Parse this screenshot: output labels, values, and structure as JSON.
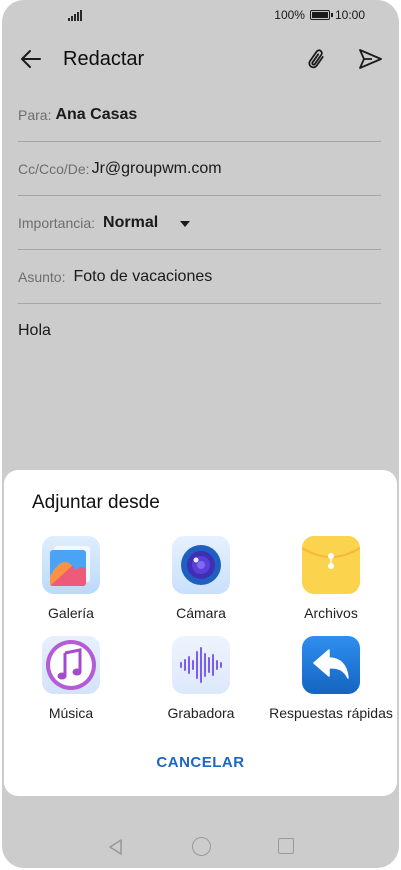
{
  "status_bar": {
    "battery_percent": "100%",
    "time": "10:00"
  },
  "app_bar": {
    "title": "Redactar"
  },
  "compose": {
    "to": {
      "label": "Para:",
      "value": "Ana Casas"
    },
    "cc": {
      "label": "Cc/Cco/De:",
      "value": "Jr@groupwm.com"
    },
    "importance": {
      "label": "Importancia:",
      "value": "Normal"
    },
    "subject": {
      "label": "Asunto:",
      "value": "Foto de vacaciones"
    },
    "body": "Hola"
  },
  "attach_sheet": {
    "title": "Adjuntar desde",
    "options": [
      {
        "label": "Galería",
        "icon": "gallery-icon"
      },
      {
        "label": "Cámara",
        "icon": "camera-icon"
      },
      {
        "label": "Archivos",
        "icon": "files-icon"
      },
      {
        "label": "Música",
        "icon": "music-icon"
      },
      {
        "label": "Grabadora",
        "icon": "recorder-icon"
      },
      {
        "label": "Respuestas rápidas",
        "icon": "quick-reply-icon"
      }
    ],
    "cancel_label": "CANCELAR"
  },
  "colors": {
    "accent": "#1b66c9",
    "scrim": "rgba(0,0,0,0.2)"
  }
}
